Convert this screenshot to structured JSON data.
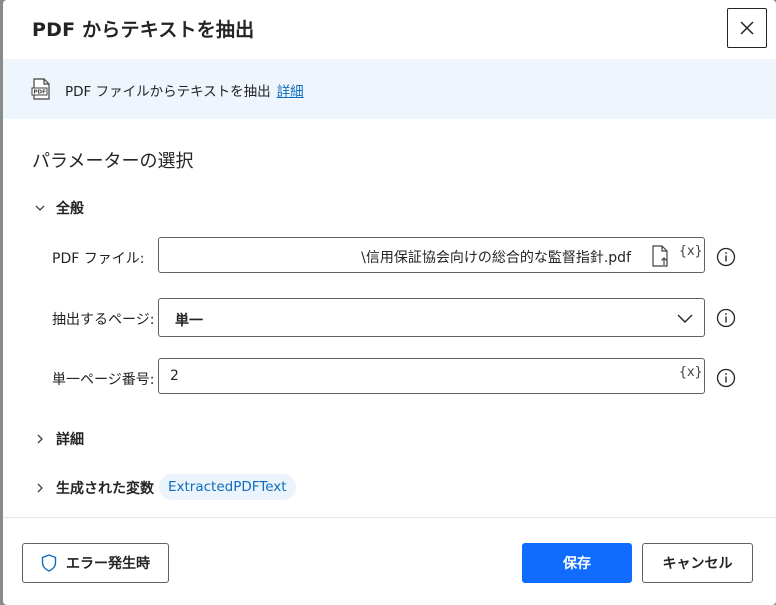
{
  "dialog": {
    "title": "PDF からテキストを抽出",
    "close_icon": "close-icon"
  },
  "info": {
    "icon": "pdf-file-icon",
    "text": "PDF ファイルからテキストを抽出",
    "link": "詳細"
  },
  "parameters": {
    "section_title": "パラメーターの選択",
    "general_group": "全般",
    "pdf_file": {
      "label": "PDF ファイル:",
      "value": "\\信用保証協会向けの総合的な監督指針.pdf",
      "file_icon": "file-upload-icon",
      "var_icon": "{x}"
    },
    "pages": {
      "label": "抽出するページ:",
      "value": "単一"
    },
    "page_number": {
      "label": "単一ページ番号:",
      "value": "2",
      "var_icon": "{x}"
    },
    "details_group": "詳細",
    "variables_group": "生成された変数",
    "variable_name": "ExtractedPDFText"
  },
  "footer": {
    "error_button": "エラー発生時",
    "save_button": "保存",
    "cancel_button": "キャンセル"
  },
  "colors": {
    "accent": "#0f6cff",
    "link": "#0f6cbd",
    "info_bg": "#eef5fd"
  }
}
